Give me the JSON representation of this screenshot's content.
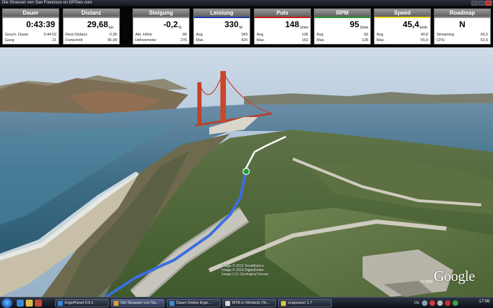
{
  "window": {
    "title": "Die Strassen von San Francisco on GPSies.com"
  },
  "tiles": [
    {
      "title": "Dauer",
      "value": "0:43:39",
      "unit": "",
      "accent": "#9a9a9a",
      "rows": [
        {
          "label": "Gesch. Dauer",
          "value": "0:44:52"
        },
        {
          "label": "Gang",
          "value": "21"
        }
      ]
    },
    {
      "title": "Distanz",
      "value": "29,68",
      "unit": "km",
      "accent": "#9a9a9a",
      "rows": [
        {
          "label": "Rest Distanz",
          "value": "0,95"
        },
        {
          "label": "Fortschritt",
          "value": "96,89"
        }
      ]
    },
    {
      "title": "Steigung",
      "value": "-0,2",
      "unit": "%",
      "accent": "#9a9a9a",
      "rows": [
        {
          "label": "Akt. Höhe",
          "value": "89"
        },
        {
          "label": "Höhenmeter",
          "value": "276"
        }
      ]
    },
    {
      "title": "Leistung",
      "value": "330",
      "unit": "W",
      "accent": "#1f3fb4",
      "rows": [
        {
          "label": "Avg.",
          "value": "343"
        },
        {
          "label": "Max.",
          "value": "420"
        }
      ]
    },
    {
      "title": "Puls",
      "value": "148",
      "unit": "1/min",
      "accent": "#d21818",
      "rows": [
        {
          "label": "Avg.",
          "value": "136"
        },
        {
          "label": "Max.",
          "value": "152"
        }
      ]
    },
    {
      "title": "RPM",
      "value": "95",
      "unit": "1/min",
      "accent": "#2b9a2b",
      "rows": [
        {
          "label": "Avg.",
          "value": "99"
        },
        {
          "label": "Max.",
          "value": "128"
        }
      ]
    },
    {
      "title": "Speed",
      "value": "45,4",
      "unit": "km/h",
      "accent": "#f0e020",
      "rows": [
        {
          "label": "Avg.",
          "value": "40,8"
        },
        {
          "label": "Max.",
          "value": "55,0"
        }
      ]
    },
    {
      "title": "Roadmap",
      "value": "N",
      "unit": "",
      "accent": "#9a9a9a",
      "rows": [
        {
          "label": "Streaming",
          "value": "66,0"
        },
        {
          "label": "CPU",
          "value": "62,6"
        }
      ]
    }
  ],
  "map": {
    "credits": [
      "Image © 2010 TerraMetrics",
      "Image © 2010 DigitalGlobe",
      "Image U.S. Geological Survey"
    ],
    "copyright": "© 2009",
    "logo": "Google",
    "colors": {
      "track": "#3b6fe0",
      "route_ahead": "#ffffff",
      "position_marker": "#1f9a3a",
      "bridge": "#c8412a"
    }
  },
  "taskbar": {
    "quick_launch": [
      "ie-icon",
      "folder-icon",
      "media-icon"
    ],
    "tasks": [
      {
        "label": "ErgoPlanet 0.6.1",
        "icon_color": "#3a8ad8",
        "active": false
      },
      {
        "label": "Die Strassen von Sa...",
        "icon_color": "#d8a23a",
        "active": true
      },
      {
        "label": "Daum Online Ergo...",
        "icon_color": "#3a8ad8",
        "active": false
      },
      {
        "label": "MTB in Windeck (Te...",
        "icon_color": "#d8d8d8",
        "active": false
      },
      {
        "label": "snapsaver 1.7",
        "icon_color": "#d8c83a",
        "active": false
      }
    ],
    "language": "DE",
    "clock": "17:06"
  }
}
